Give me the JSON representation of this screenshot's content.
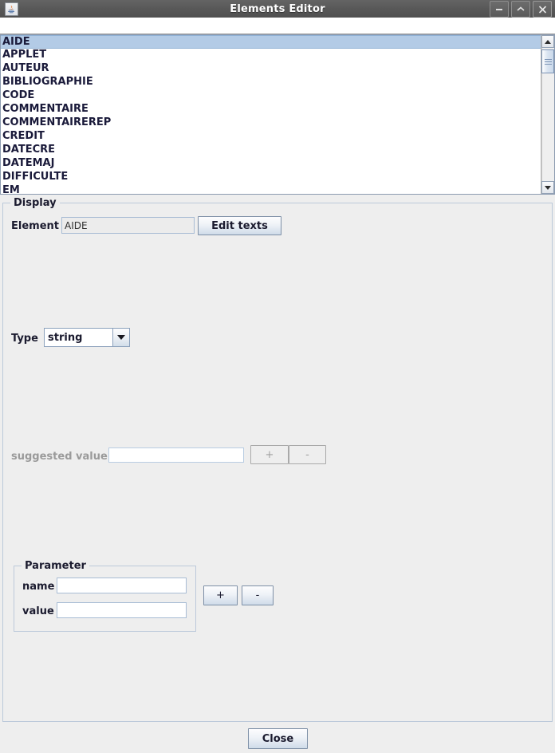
{
  "window": {
    "title": "Elements Editor",
    "icon": "java-coffee-cup-icon",
    "controls": {
      "minimize": "–",
      "maximize": "⌃",
      "close": "✕"
    }
  },
  "element_list": {
    "items": [
      "AIDE",
      "APPLET",
      "AUTEUR",
      "BIBLIOGRAPHIE",
      "CODE",
      "COMMENTAIRE",
      "COMMENTAIREREP",
      "CREDIT",
      "DATECRE",
      "DATEMAJ",
      "DIFFICULTE",
      "EM"
    ],
    "selected": "AIDE",
    "selected_index": 0
  },
  "display_panel": {
    "title": "Display",
    "element_label": "Element",
    "element_value": "AIDE",
    "edit_texts_label": "Edit texts",
    "type_label": "Type",
    "type_value": "string",
    "type_options": [
      "string"
    ],
    "suggested_value_label": "suggested value",
    "suggested_value": "",
    "suggested_add_label": "+",
    "suggested_remove_label": "-"
  },
  "parameter_group": {
    "title": "Parameter",
    "name_label": "name",
    "name_value": "",
    "value_label": "value",
    "value_value": "",
    "add_label": "+",
    "remove_label": "-"
  },
  "footer": {
    "close_label": "Close"
  },
  "colors": {
    "titlebar": "#595959",
    "panel": "#eeeeee",
    "selection": "#b3cbe6",
    "border": "#bcc9da",
    "text": "#1b1b2f",
    "disabled_text": "#9a9a9a"
  }
}
